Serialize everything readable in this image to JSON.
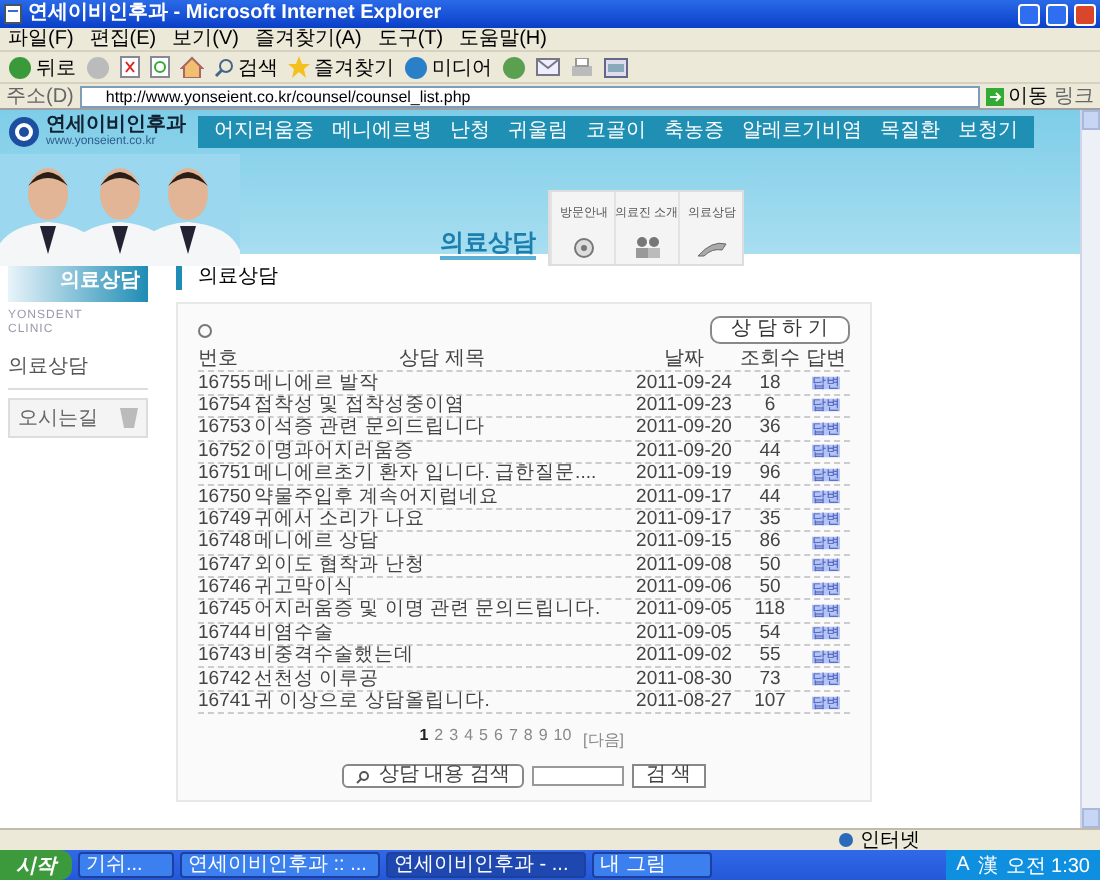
{
  "window": {
    "title": "연세이비인후과 - Microsoft Internet Explorer"
  },
  "menu": [
    "파일(F)",
    "편집(E)",
    "보기(V)",
    "즐겨찾기(A)",
    "도구(T)",
    "도움말(H)"
  ],
  "toolbar": {
    "back": "뒤로",
    "search": "검색",
    "favorites": "즐겨찾기",
    "media": "미디어"
  },
  "address": {
    "label": "주소(D)",
    "url": "http://www.yonseient.co.kr/counsel/counsel_list.php",
    "go": "이동",
    "links": "링크"
  },
  "site": {
    "logo": "연세이비인후과",
    "domain": "www.yonseient.co.kr",
    "nav": [
      "어지러움증",
      "메니에르병",
      "난청",
      "귀울림",
      "코골이",
      "축농증",
      "알레르기비염",
      "목질환",
      "보청기"
    ],
    "section_title": "의료상담",
    "quick_tabs": [
      {
        "label": "방문안내",
        "kind": "disc"
      },
      {
        "label": "의료진 소개",
        "kind": "people"
      },
      {
        "label": "의료상담",
        "kind": "phone"
      }
    ]
  },
  "sidebar": {
    "heading": "의료상담",
    "clinic_logo": [
      "YONSDENT",
      "CLINIC"
    ],
    "items": [
      "의료상담"
    ],
    "directions": "오시는길"
  },
  "content": {
    "heading": "의료상담",
    "write_button": "상 담 하 기",
    "columns": [
      "번호",
      "상담 제목",
      "날짜",
      "조회수",
      "답변"
    ],
    "rows": [
      {
        "no": "16755",
        "title": "메니에르 발작",
        "date": "2011-09-24",
        "views": "18",
        "answer": "답변"
      },
      {
        "no": "16754",
        "title": "접착성 및 접착성중이염",
        "date": "2011-09-23",
        "views": "6",
        "answer": "답변"
      },
      {
        "no": "16753",
        "title": "이석증 관련 문의드립니다",
        "date": "2011-09-20",
        "views": "36",
        "answer": "답변"
      },
      {
        "no": "16752",
        "title": "이명과어지러움증",
        "date": "2011-09-20",
        "views": "44",
        "answer": "답변"
      },
      {
        "no": "16751",
        "title": "메니에르초기 환자 입니다. 급한질문....",
        "date": "2011-09-19",
        "views": "96",
        "answer": "답변"
      },
      {
        "no": "16750",
        "title": "약물주입후 계속어지럽네요",
        "date": "2011-09-17",
        "views": "44",
        "answer": "답변"
      },
      {
        "no": "16749",
        "title": "귀에서 소리가 나요",
        "date": "2011-09-17",
        "views": "35",
        "answer": "답변"
      },
      {
        "no": "16748",
        "title": "메니에르 상담",
        "date": "2011-09-15",
        "views": "86",
        "answer": "답변"
      },
      {
        "no": "16747",
        "title": "외이도 협착과 난청",
        "date": "2011-09-08",
        "views": "50",
        "answer": "답변"
      },
      {
        "no": "16746",
        "title": "귀고막이식",
        "date": "2011-09-06",
        "views": "50",
        "answer": "답변"
      },
      {
        "no": "16745",
        "title": "어지러움증 및 이명 관련 문의드립니다.",
        "date": "2011-09-05",
        "views": "118",
        "answer": "답변"
      },
      {
        "no": "16744",
        "title": "비염수술",
        "date": "2011-09-05",
        "views": "54",
        "answer": "답변"
      },
      {
        "no": "16743",
        "title": "비중격수술했는데",
        "date": "2011-09-02",
        "views": "55",
        "answer": "답변"
      },
      {
        "no": "16742",
        "title": "선천성 이루공",
        "date": "2011-08-30",
        "views": "73",
        "answer": "답변"
      },
      {
        "no": "16741",
        "title": "귀 이상으로 상담올립니다.",
        "date": "2011-08-27",
        "views": "107",
        "answer": "답변"
      }
    ],
    "pages": [
      {
        "label": "1",
        "selected": true
      },
      {
        "label": "2",
        "selected": false
      },
      {
        "label": "3",
        "selected": false
      },
      {
        "label": "4",
        "selected": false
      },
      {
        "label": "5",
        "selected": false
      },
      {
        "label": "6",
        "selected": false
      },
      {
        "label": "7",
        "selected": false
      },
      {
        "label": "8",
        "selected": false
      },
      {
        "label": "9",
        "selected": false
      },
      {
        "label": "10",
        "selected": false
      }
    ],
    "next": "[다음]",
    "search_button": "상담 내용 검색",
    "search_submit": "검 색"
  },
  "status_bar": {
    "zone": "인터넷"
  },
  "taskbar": {
    "start": "시작",
    "tasks": [
      {
        "label": "기쉬...",
        "selected": false
      },
      {
        "label": "연세이비인후과 :: ...",
        "selected": false
      },
      {
        "label": "연세이비인후과 - ...",
        "selected": true
      },
      {
        "label": "내 그림",
        "selected": false
      }
    ],
    "language": [
      "A",
      "漢"
    ],
    "clock": "오전 1:30"
  }
}
